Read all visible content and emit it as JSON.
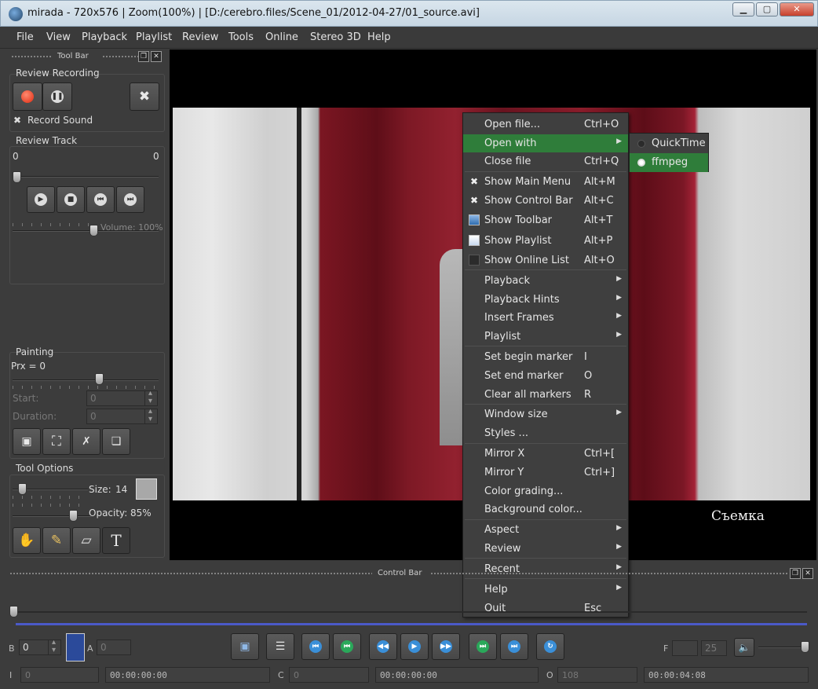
{
  "window": {
    "title": "mirada - 720x576 | Zoom(100%) | [D:/cerebro.files/Scene_01/2012-04-27/01_source.avi]",
    "minimize": "▁",
    "maximize": "▢",
    "close": "✕"
  },
  "menubar": [
    "File",
    "View",
    "Playback",
    "Playlist",
    "Review",
    "Tools",
    "Online",
    "Stereo 3D",
    "Help"
  ],
  "toolbar": {
    "header": "Tool Bar",
    "review_recording": {
      "title": "Review Recording",
      "record_sound_label": "Record Sound",
      "record_sound_checked": true
    },
    "review_track": {
      "title": "Review Track",
      "left_value": "0",
      "right_value": "0",
      "volume_label": "Volume: 100%"
    },
    "painting": {
      "title": "Painting",
      "prx_label": "Prx = 0",
      "start_label": "Start:",
      "start_value": "0",
      "duration_label": "Duration:",
      "duration_value": "0"
    },
    "tool_options": {
      "title": "Tool Options",
      "size_label": "Size:",
      "size_value": "14",
      "opacity_label": "Opacity:",
      "opacity_value": "85%",
      "text_tool_glyph": "T"
    }
  },
  "viewer": {
    "caption": "Съемка"
  },
  "context_menu": {
    "items": [
      {
        "label": "Open file...",
        "shortcut": "Ctrl+O"
      },
      {
        "label": "Open with",
        "submenu": true,
        "active": true
      },
      {
        "label": "Close file",
        "shortcut": "Ctrl+Q"
      },
      {
        "label": "Show Main Menu",
        "shortcut": "Alt+M",
        "icon": "check"
      },
      {
        "label": "Show Control Bar",
        "shortcut": "Alt+C",
        "icon": "check"
      },
      {
        "label": "Show Toolbar",
        "shortcut": "Alt+T",
        "icon": "toolbar"
      },
      {
        "label": "Show Playlist",
        "shortcut": "Alt+P",
        "icon": "playlist"
      },
      {
        "label": "Show Online List",
        "shortcut": "Alt+O",
        "icon": "empty"
      },
      {
        "label": "Playback",
        "submenu": true
      },
      {
        "label": "Playback Hints",
        "submenu": true
      },
      {
        "label": "Insert Frames",
        "submenu": true
      },
      {
        "label": "Playlist",
        "submenu": true
      },
      {
        "label": "Set begin marker",
        "shortcut": "I"
      },
      {
        "label": "Set end marker",
        "shortcut": "O"
      },
      {
        "label": "Clear all markers",
        "shortcut": "R"
      },
      {
        "label": "Window size",
        "submenu": true
      },
      {
        "label": "Styles ..."
      },
      {
        "label": "Mirror X",
        "shortcut": "Ctrl+["
      },
      {
        "label": "Mirror Y",
        "shortcut": "Ctrl+]"
      },
      {
        "label": "Color grading..."
      },
      {
        "label": "Background color..."
      },
      {
        "label": "Aspect",
        "submenu": true
      },
      {
        "label": "Review",
        "submenu": true
      },
      {
        "label": "Recent",
        "submenu": true
      },
      {
        "label": "Help",
        "submenu": true
      },
      {
        "label": "Quit",
        "shortcut": "Esc"
      }
    ],
    "submenu_arrow": "▶"
  },
  "open_with_submenu": [
    {
      "label": "QuickTime",
      "selected": false
    },
    {
      "label": "ffmpeg",
      "selected": true
    }
  ],
  "control_bar": {
    "header": "Control Bar",
    "b_label": "B",
    "b_value": "0",
    "a_label": "A",
    "a_value": "0",
    "f_label": "F",
    "f_value": "",
    "fps_value": "25",
    "i_label": "I",
    "i_value": "0",
    "i_time": "00:00:00:00",
    "c_label": "C",
    "c_value": "0",
    "c_time": "00:00:00:00",
    "o_label": "O",
    "o_value": "108",
    "o_time": "00:00:04:08"
  }
}
